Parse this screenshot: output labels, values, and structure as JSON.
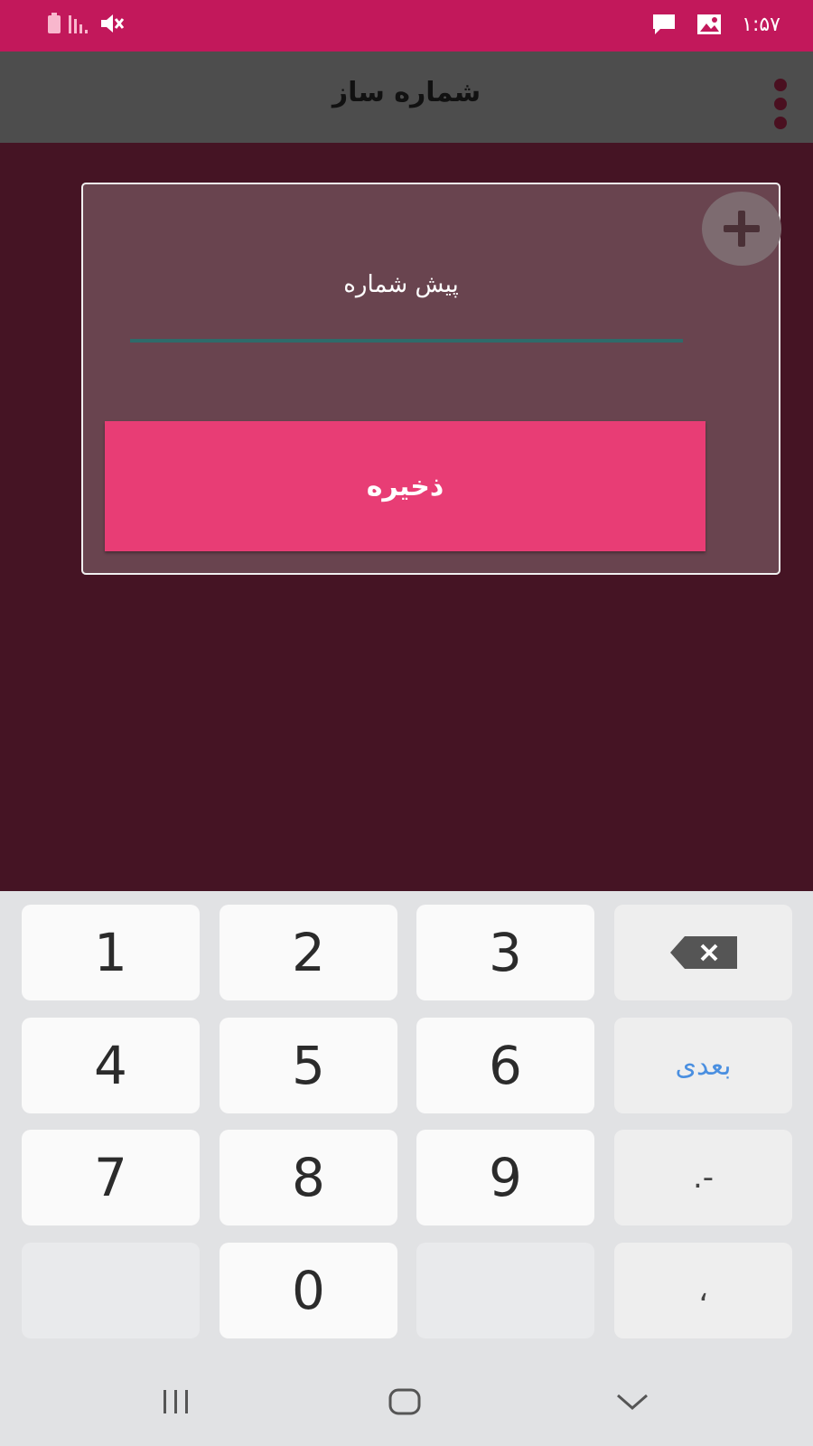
{
  "status_bar": {
    "time": "۱:۵۷",
    "icons": [
      "battery-icon",
      "signal-icon",
      "mute-icon",
      "message-icon",
      "gallery-icon"
    ]
  },
  "app_bar": {
    "title": "شماره ساز",
    "menu_icon": "more-vert-icon"
  },
  "form": {
    "prefix_label": "پیش شماره",
    "save_label": "ذخیره",
    "add_icon": "add-circle-icon"
  },
  "keyboard": {
    "rows": [
      [
        "1",
        "2",
        "3",
        "backspace"
      ],
      [
        "4",
        "5",
        "6",
        "بعدی"
      ],
      [
        "7",
        "8",
        "9",
        ".-"
      ],
      [
        "",
        "0",
        "",
        "،"
      ]
    ],
    "k1": "1",
    "k2": "2",
    "k3": "3",
    "k4": "4",
    "k5": "5",
    "k6": "6",
    "k7": "7",
    "k8": "8",
    "k9": "9",
    "k0": "0",
    "next": "بعدی",
    "dot_dash": ".-",
    "comma": "،"
  },
  "nav_bar": {
    "icons": [
      "recent-apps-icon",
      "home-icon",
      "back-icon"
    ]
  },
  "colors": {
    "status_bar": "#c2185b",
    "app_bar": "#4d4d4d",
    "background": "#451424",
    "card": "#69444f",
    "save_button": "#e83d75",
    "underline": "#2e6b6a",
    "keyboard": "#e1e2e4",
    "next_key_text": "#4a8fe0"
  }
}
